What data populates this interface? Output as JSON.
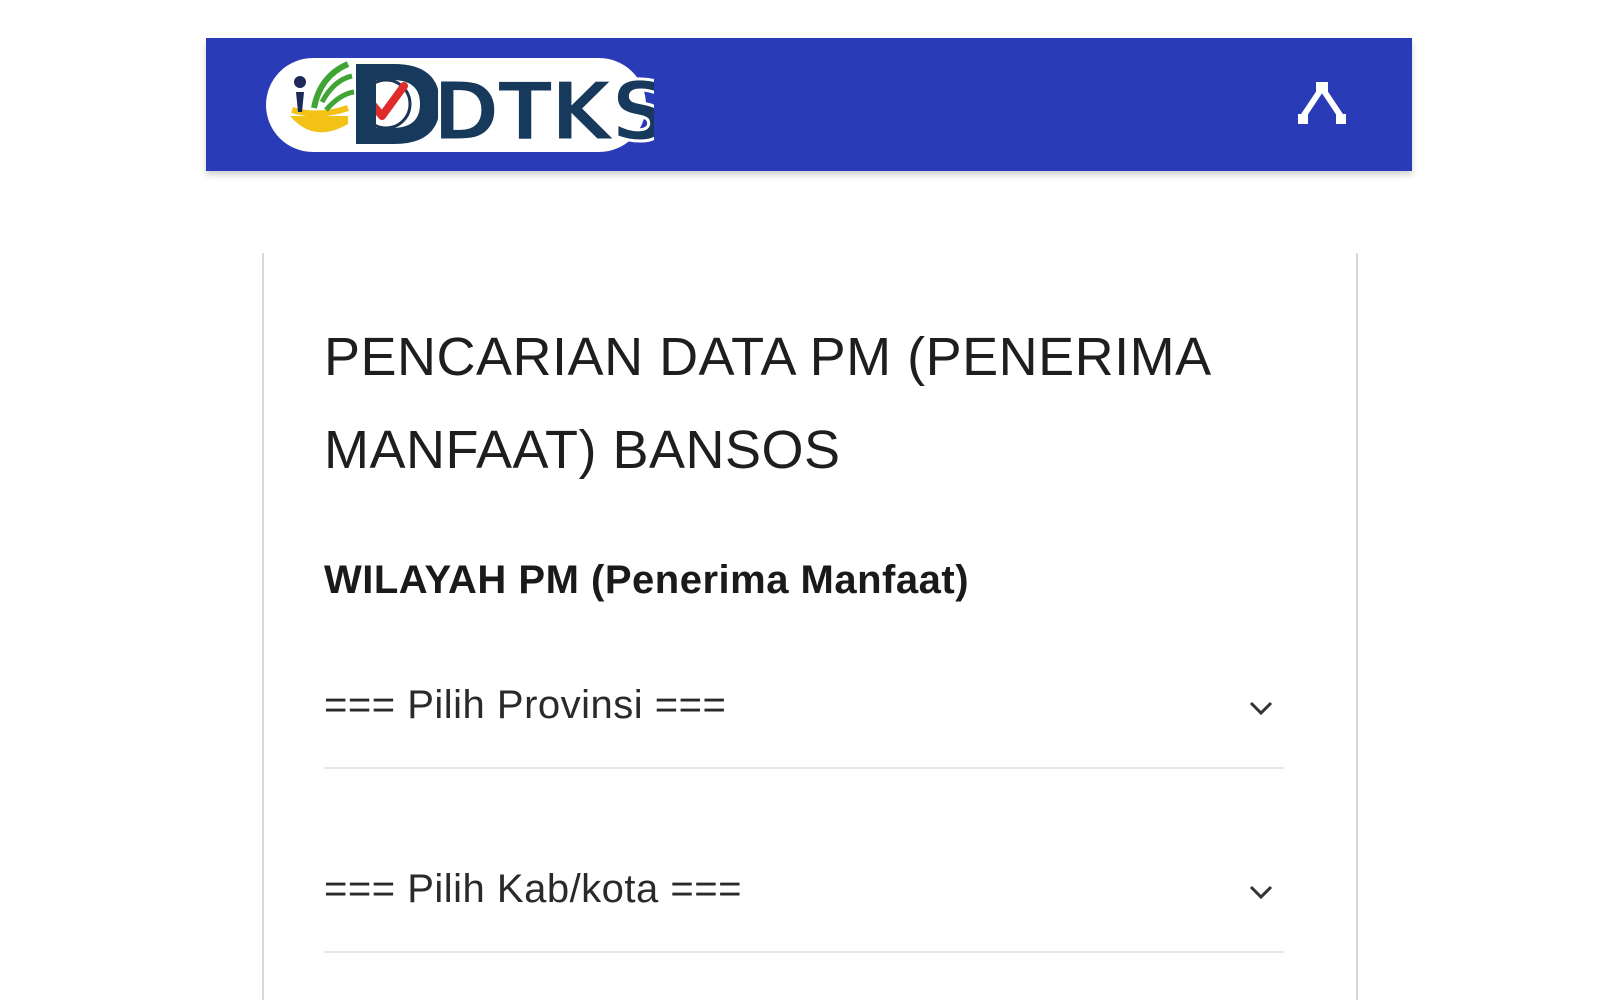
{
  "header": {
    "logo_text": "DTKS",
    "menu_icon": "chevron-up-icon",
    "background_color": "#2a3bb7"
  },
  "main": {
    "title": "PENCARIAN DATA PM (PENERIMA MANFAAT) BANSOS",
    "section_label": "WILAYAH PM (Penerima Manfaat)",
    "selects": [
      {
        "selected": "=== Pilih Provinsi ==="
      },
      {
        "selected": "=== Pilih Kab/kota ==="
      }
    ]
  }
}
